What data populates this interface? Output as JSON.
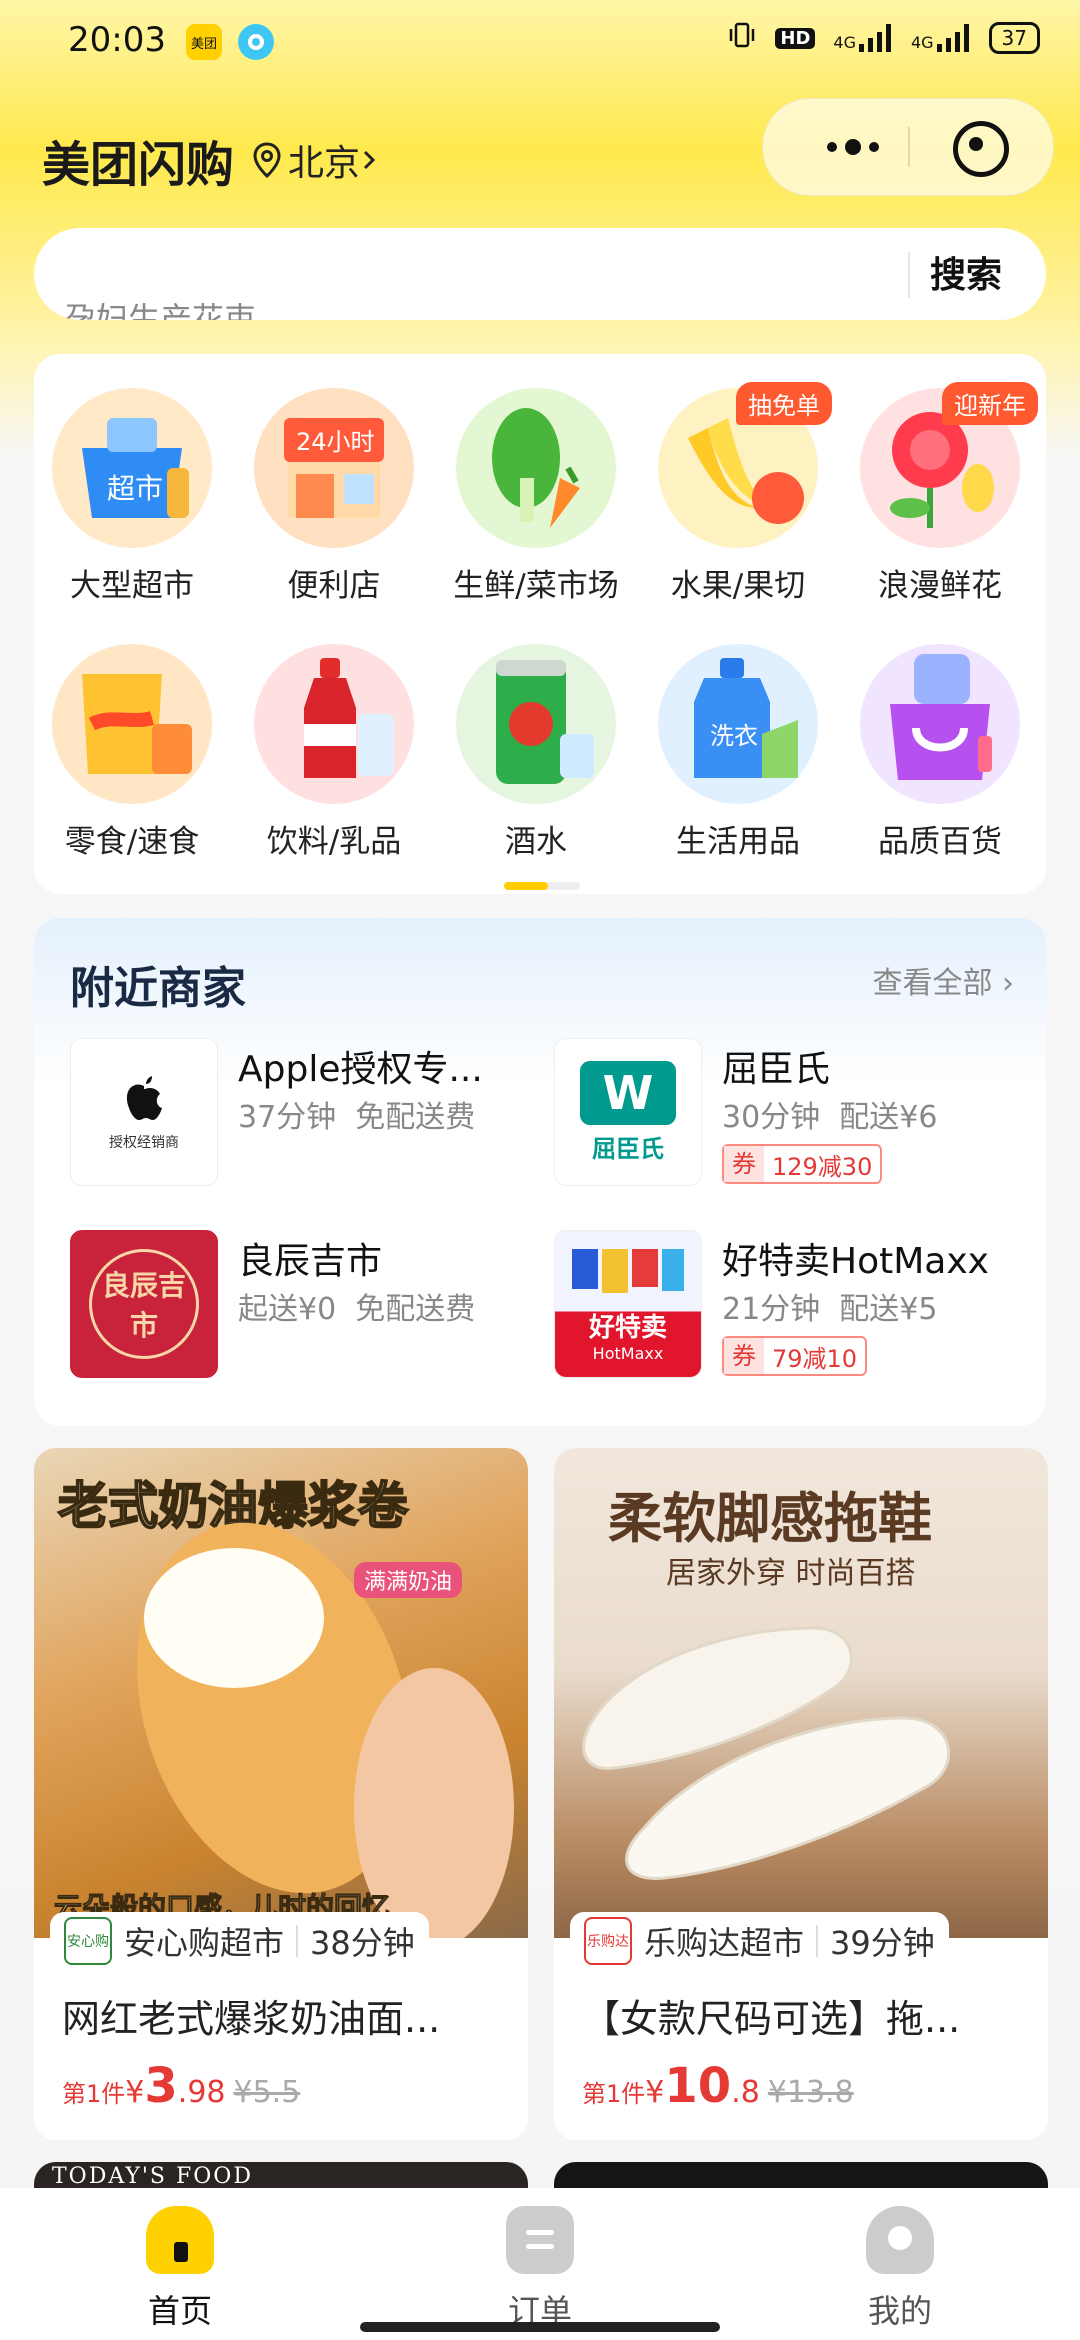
{
  "status": {
    "time": "20:03",
    "app_icon_1": "美团",
    "network": "4G",
    "network2": "4G",
    "battery": "37"
  },
  "header": {
    "title": "美团闪购",
    "location": "北京"
  },
  "search": {
    "placeholder": "孕妇生产花束",
    "button": "搜索"
  },
  "categories": [
    {
      "label": "大型超市",
      "badge": "",
      "icon": "supermarket-basket"
    },
    {
      "label": "便利店",
      "badge": "",
      "icon": "convenience-store"
    },
    {
      "label": "生鲜/菜市场",
      "badge": "",
      "icon": "vegetables"
    },
    {
      "label": "水果/果切",
      "badge": "抽免单",
      "icon": "fruits"
    },
    {
      "label": "浪漫鲜花",
      "badge": "迎新年",
      "icon": "rose"
    },
    {
      "label": "零食/速食",
      "badge": "",
      "icon": "snacks"
    },
    {
      "label": "饮料/乳品",
      "badge": "",
      "icon": "drinks"
    },
    {
      "label": "酒水",
      "badge": "",
      "icon": "beer-can"
    },
    {
      "label": "生活用品",
      "badge": "",
      "icon": "detergent"
    },
    {
      "label": "品质百货",
      "badge": "",
      "icon": "shopping-bag"
    }
  ],
  "nearby": {
    "title": "附近商家",
    "view_all": "查看全部",
    "merchants": [
      {
        "name": "Apple授权专...",
        "logo_text": "授权经销商",
        "meta1": "37分钟",
        "meta2": "免配送费",
        "coupon": ""
      },
      {
        "name": "屈臣氏",
        "logo_text": "屈臣氏",
        "meta1": "30分钟",
        "meta2": "配送¥6",
        "coupon": "129减30"
      },
      {
        "name": "良辰吉市",
        "logo_text": "良辰吉市",
        "meta1": "起送¥0",
        "meta2": "免配送费",
        "coupon": ""
      },
      {
        "name": "好特卖HotMaxx",
        "logo_text": "好特卖",
        "logo_sub": "HotMaxx",
        "meta1": "21分钟",
        "meta2": "配送¥5",
        "coupon": "79减10"
      }
    ],
    "coupon_tag": "券"
  },
  "products": [
    {
      "banner": "老式奶油爆浆卷",
      "sticker": "满满奶油",
      "caption": "云朵般的口感，儿时的回忆",
      "shop": "安心购超市",
      "shop_logo": "安心购",
      "time": "38分钟",
      "title": "网红老式爆浆奶油面...",
      "price_prefix": "第1件",
      "price_currency": "¥",
      "price_int": "3",
      "price_dec": ".98",
      "price_old": "¥5.5"
    },
    {
      "banner": "柔软脚感拖鞋",
      "sub_banner": "居家外穿 时尚百搭",
      "shop": "乐购达超市",
      "shop_logo": "乐购达",
      "time": "39分钟",
      "title": "【女款尺码可选】拖...",
      "price_prefix": "第1件",
      "price_currency": "¥",
      "price_int": "10",
      "price_dec": ".8",
      "price_old": "¥13.8"
    }
  ],
  "peek": {
    "left_text": "TODAY'S FOOD"
  },
  "tabs": [
    {
      "label": "首页",
      "icon": "home-icon",
      "active_color": "#ffd100"
    },
    {
      "label": "订单",
      "icon": "order-icon"
    },
    {
      "label": "我的",
      "icon": "profile-icon"
    }
  ]
}
